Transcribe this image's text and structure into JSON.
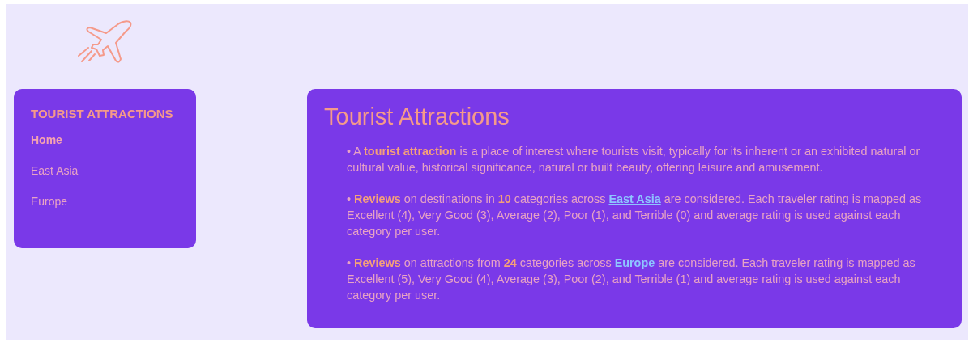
{
  "sidebar": {
    "title": "TOURIST ATTRACTIONS",
    "items": [
      {
        "label": "Home",
        "selected": true
      },
      {
        "label": "East Asia",
        "selected": false
      },
      {
        "label": "Europe",
        "selected": false
      }
    ]
  },
  "main": {
    "title": "Tourist Attractions",
    "paragraphs": [
      {
        "text": "• A **tourist attraction** is a place of interest where tourists visit, typically for its inherent or an exhibited natural or cultural value, historical significance, natural or built beauty, offering leisure and amusement."
      },
      {
        "text": "• **Reviews** on destinations in **10** categories across ",
        "link": "East Asia",
        "after": " are considered. Each traveler rating is mapped as Excellent (4), Very Good (3), Average (2), Poor (1), and Terrible (0) and average rating is used against each category per user."
      },
      {
        "text": "• **Reviews** on attractions from **24** categories across ",
        "link": "Europe",
        "after": " are considered. Each traveler rating is mapped as Excellent (5), Very Good (4), Average (3), Poor (2), and Terrible (1) and average rating is used against each category per user."
      }
    ]
  }
}
